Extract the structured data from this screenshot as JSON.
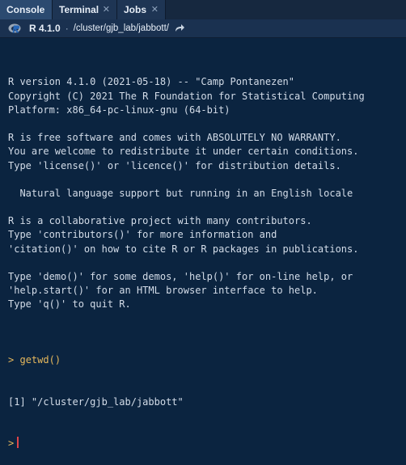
{
  "tabs": [
    {
      "label": "Console",
      "active": true,
      "closable": false
    },
    {
      "label": "Terminal",
      "active": false,
      "closable": true
    },
    {
      "label": "Jobs",
      "active": false,
      "closable": true
    }
  ],
  "pathbar": {
    "r_version": "R 4.1.0",
    "separator": "·",
    "working_dir": "/cluster/gjb_lab/jabbott/"
  },
  "console": {
    "startup_lines": [
      "R version 4.1.0 (2021-05-18) -- \"Camp Pontanezen\"",
      "Copyright (C) 2021 The R Foundation for Statistical Computing",
      "Platform: x86_64-pc-linux-gnu (64-bit)",
      "",
      "R is free software and comes with ABSOLUTELY NO WARRANTY.",
      "You are welcome to redistribute it under certain conditions.",
      "Type 'license()' or 'licence()' for distribution details.",
      "",
      "  Natural language support but running in an English locale",
      "",
      "R is a collaborative project with many contributors.",
      "Type 'contributors()' for more information and",
      "'citation()' on how to cite R or R packages in publications.",
      "",
      "Type 'demo()' for some demos, 'help()' for on-line help, or",
      "'help.start()' for an HTML browser interface to help.",
      "Type 'q()' to quit R.",
      ""
    ],
    "prompt_symbol": ">",
    "command": "getwd()",
    "output": "[1] \"/cluster/gjb_lab/jabbott\""
  },
  "colors": {
    "background": "#0b2440",
    "prompt": "#e6b85c",
    "cursor": "#e0444a"
  },
  "icons": {
    "r_logo": "r-logo-icon",
    "goto_dir": "arrow-forward-icon",
    "close": "close-icon"
  }
}
